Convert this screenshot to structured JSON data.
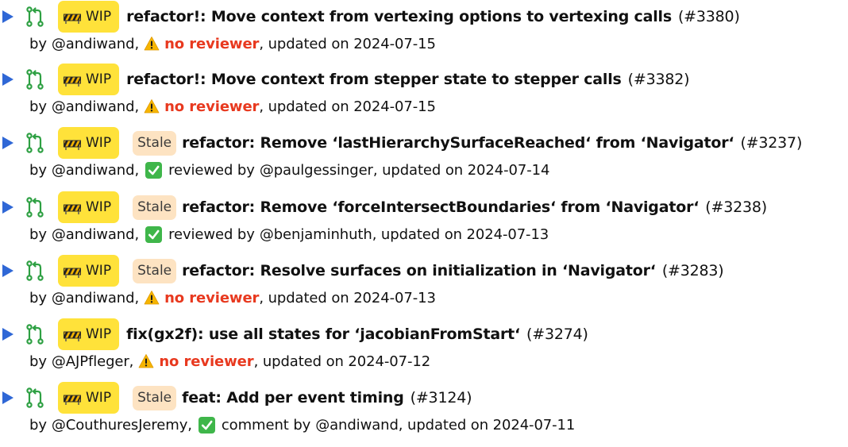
{
  "colors": {
    "arrow": "#2f67d6",
    "wip_badge": "#ffe23a",
    "stale_badge": "#fde3c2",
    "no_reviewer": "#e8391f",
    "check": "#3fb64a",
    "merge_icon": "#2ea043"
  },
  "icons": [
    "expand-arrow-icon",
    "merge-request-icon",
    "construction-barrier-icon",
    "warning-icon",
    "checkmark-icon"
  ],
  "prs": [
    {
      "wip": "WIP",
      "stale": "",
      "title": "refactor!: Move context from vertexing options to vertexing calls",
      "number": "(#3380)",
      "by": "by",
      "author": "@andiwand,",
      "status": "no_reviewer",
      "review_text": "no reviewer",
      "reviewer": "",
      "updated": ", updated on 2024-07-15"
    },
    {
      "wip": "WIP",
      "stale": "",
      "title": "refactor!: Move context from stepper state to stepper calls",
      "number": "(#3382)",
      "by": "by",
      "author": "@andiwand,",
      "status": "no_reviewer",
      "review_text": "no reviewer",
      "reviewer": "",
      "updated": ", updated on 2024-07-15"
    },
    {
      "wip": "WIP",
      "stale": "Stale",
      "title": "refactor: Remove ‘lastHierarchySurfaceReached‘ from ‘Navigator‘",
      "number": "(#3237)",
      "by": "by",
      "author": "@andiwand,",
      "status": "reviewed",
      "review_text": "reviewed by",
      "reviewer": "@paulgessinger",
      "updated": ", updated on 2024-07-14"
    },
    {
      "wip": "WIP",
      "stale": "Stale",
      "title": "refactor: Remove ‘forceIntersectBoundaries‘ from ‘Navigator‘",
      "number": "(#3238)",
      "by": "by",
      "author": "@andiwand,",
      "status": "reviewed",
      "review_text": "reviewed by",
      "reviewer": "@benjaminhuth",
      "updated": ", updated on 2024-07-13"
    },
    {
      "wip": "WIP",
      "stale": "Stale",
      "title": "refactor: Resolve surfaces on initialization in ‘Navigator‘",
      "number": "(#3283)",
      "by": "by",
      "author": "@andiwand,",
      "status": "no_reviewer",
      "review_text": "no reviewer",
      "reviewer": "",
      "updated": ", updated on 2024-07-13"
    },
    {
      "wip": "WIP",
      "stale": "",
      "title": "fix(gx2f): use all states for ‘jacobianFromStart‘",
      "number": "(#3274)",
      "by": "by",
      "author": "@AJPfleger,",
      "status": "no_reviewer",
      "review_text": "no reviewer",
      "reviewer": "",
      "updated": ", updated on 2024-07-12"
    },
    {
      "wip": "WIP",
      "stale": "Stale",
      "title": "feat: Add per event timing",
      "number": "(#3124)",
      "by": "by",
      "author": "@CouthuresJeremy,",
      "status": "reviewed",
      "review_text": "comment by",
      "reviewer": "@andiwand",
      "updated": ", updated on 2024-07-11"
    }
  ]
}
